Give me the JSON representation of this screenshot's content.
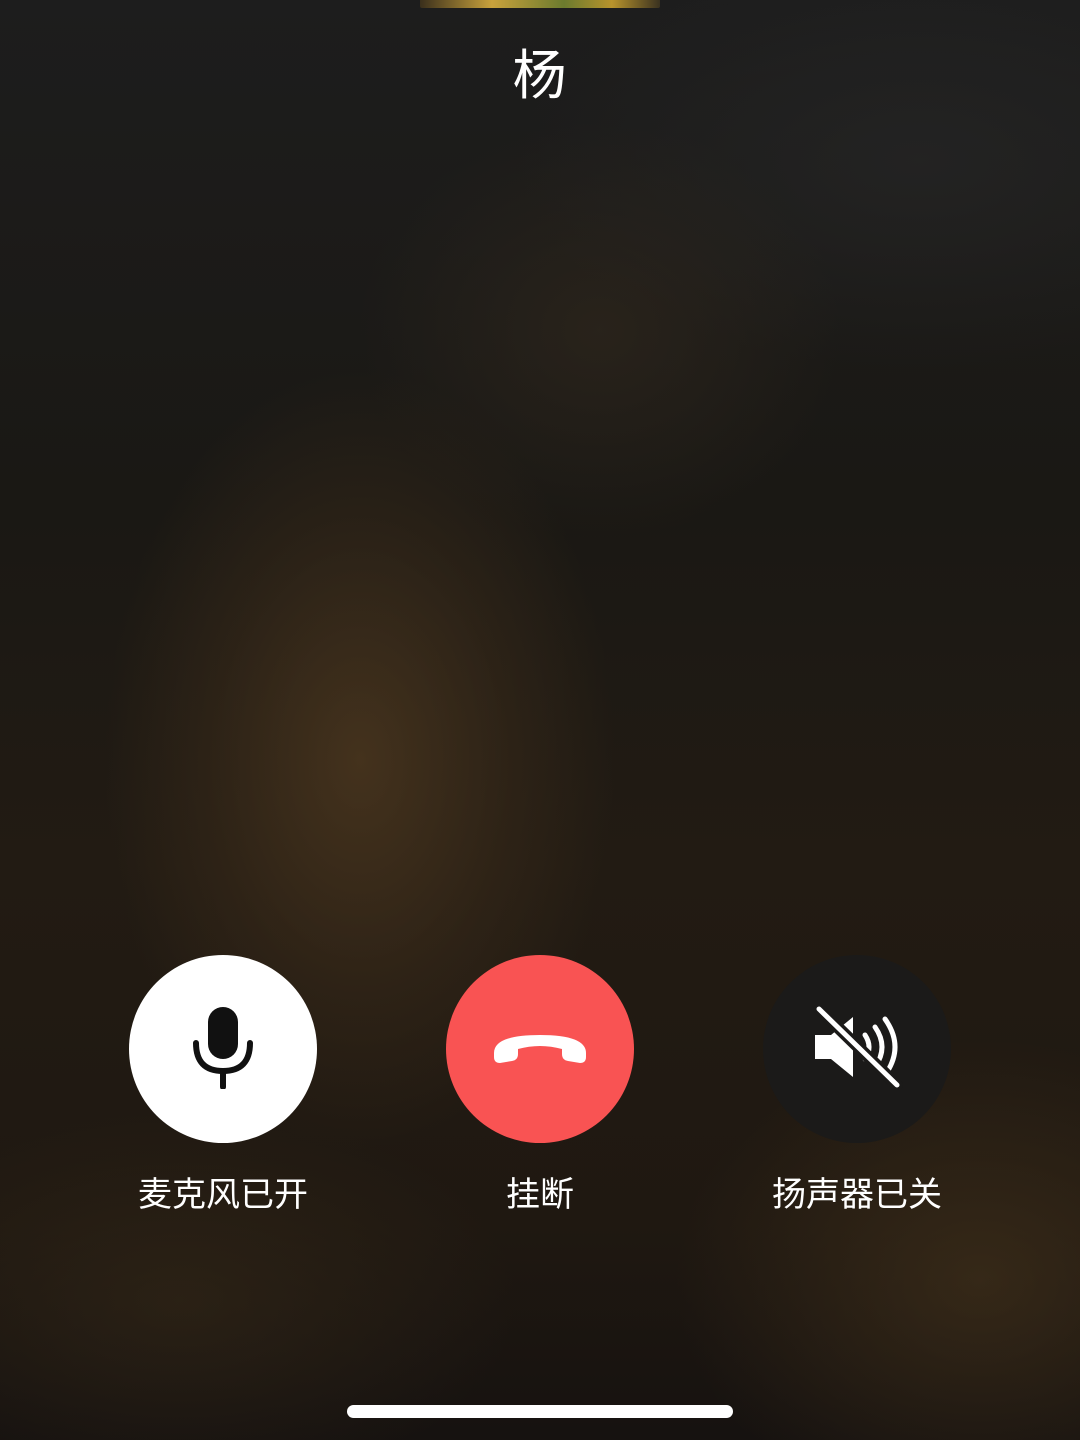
{
  "call": {
    "caller_name": "杨"
  },
  "controls": {
    "mic": {
      "label": "麦克风已开",
      "icon": "microphone-icon",
      "state": "on"
    },
    "hangup": {
      "label": "挂断",
      "icon": "phone-hangup-icon",
      "color": "#f95353"
    },
    "speaker": {
      "label": "扬声器已关",
      "icon": "speaker-muted-icon",
      "state": "off"
    }
  }
}
